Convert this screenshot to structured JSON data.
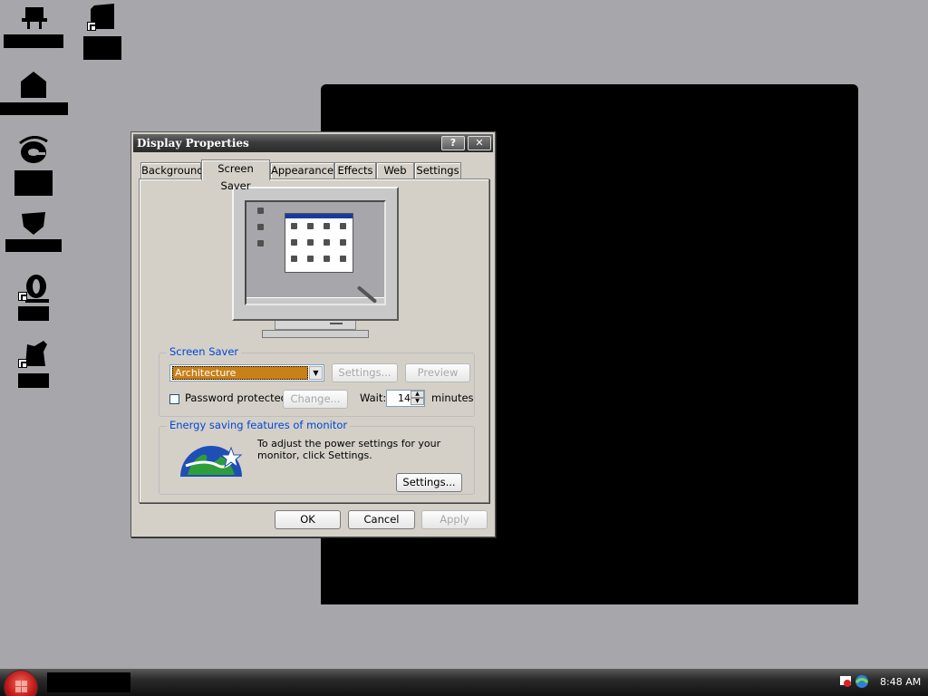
{
  "dialog": {
    "title": "Display Properties",
    "help_label": "?",
    "close_label": "✕",
    "tabs": [
      {
        "label": "Background",
        "active": false
      },
      {
        "label": "Screen Saver",
        "active": true
      },
      {
        "label": "Appearance",
        "active": false
      },
      {
        "label": "Effects",
        "active": false
      },
      {
        "label": "Web",
        "active": false
      },
      {
        "label": "Settings",
        "active": false
      }
    ],
    "screen_saver": {
      "group_label": "Screen Saver",
      "selected": "Architecture",
      "settings_label": "Settings...",
      "preview_label": "Preview",
      "password_label": "Password protected",
      "password_checked": false,
      "change_label": "Change...",
      "wait_label": "Wait:",
      "wait_value": "14",
      "minutes_label": "minutes"
    },
    "energy": {
      "group_label": "Energy saving features of monitor",
      "description": "To adjust the power settings for your monitor, click Settings.",
      "settings_label": "Settings..."
    },
    "buttons": {
      "ok": "OK",
      "cancel": "Cancel",
      "apply": "Apply"
    }
  },
  "taskbar": {
    "clock": "8:48 AM"
  },
  "colors": {
    "desktop": "#a7a6aa",
    "dialog_face": "#d4d0c8",
    "group_label": "#0046d5",
    "selection": "#c88018"
  },
  "icons": [
    "monitor-desk-icon",
    "folder-icon",
    "home-icon",
    "internet-explorer-icon",
    "shield-icon",
    "outlook-icon",
    "paint-icon",
    "energy-star-icon",
    "start-orb-icon"
  ]
}
